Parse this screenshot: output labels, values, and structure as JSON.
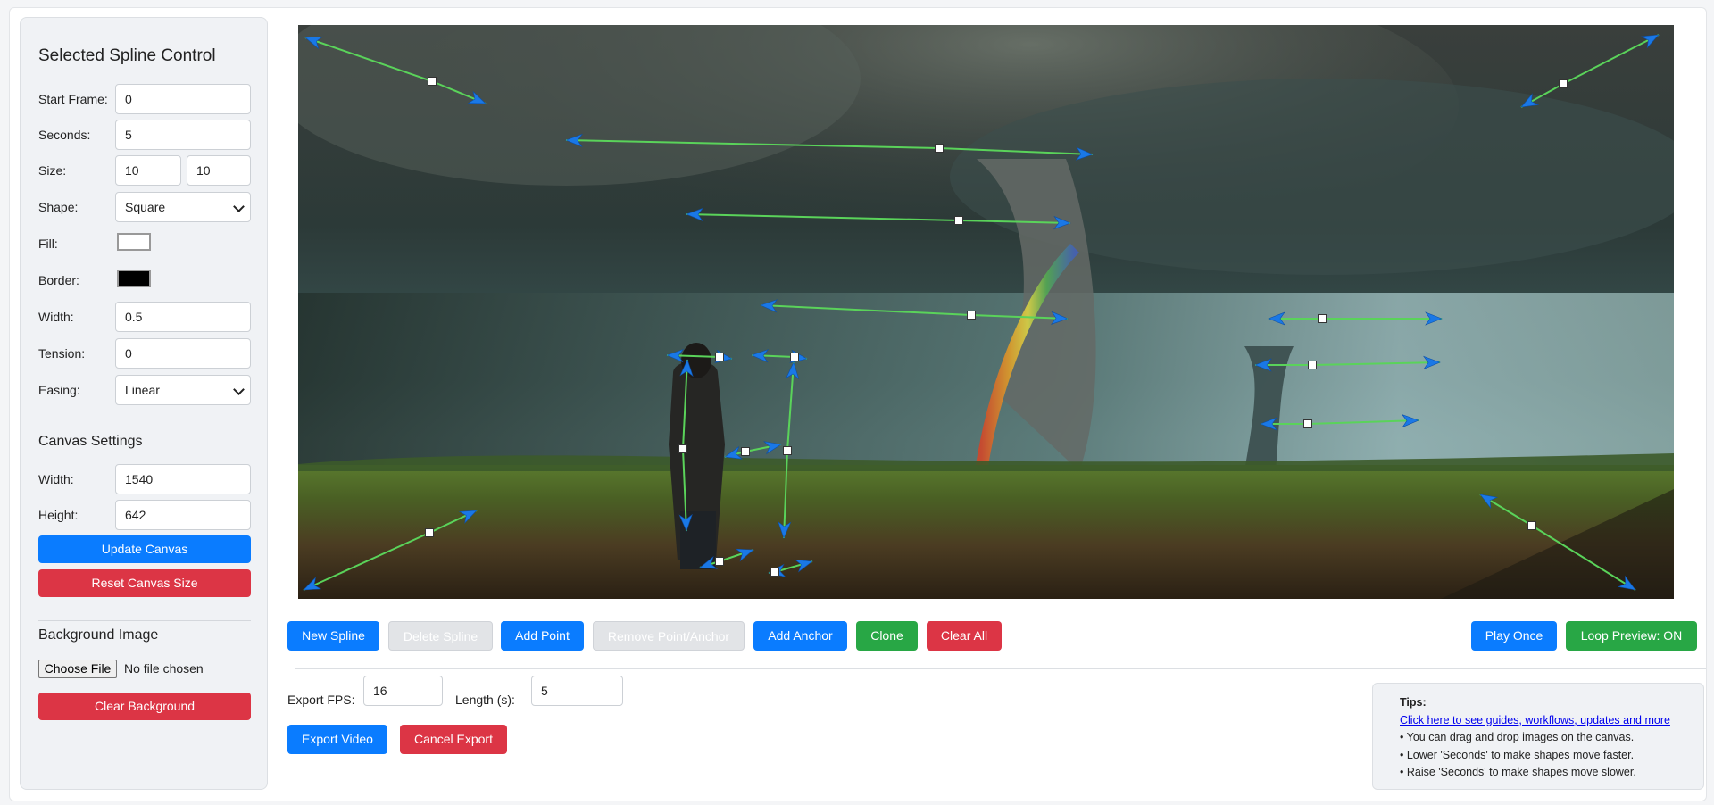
{
  "sidebar": {
    "title": "Selected Spline Control",
    "fields": {
      "start_frame": {
        "label": "Start Frame:",
        "value": "0"
      },
      "seconds": {
        "label": "Seconds:",
        "value": "5"
      },
      "size": {
        "label": "Size:",
        "value_w": "10",
        "value_h": "10"
      },
      "shape": {
        "label": "Shape:",
        "value": "Square"
      },
      "fill": {
        "label": "Fill:",
        "color": "#ffffff"
      },
      "border": {
        "label": "Border:",
        "color": "#000000"
      },
      "width": {
        "label": "Width:",
        "value": "0.5"
      },
      "tension": {
        "label": "Tension:",
        "value": "0"
      },
      "easing": {
        "label": "Easing:",
        "value": "Linear"
      }
    },
    "canvas_settings": {
      "title": "Canvas Settings",
      "width_label": "Width:",
      "width_value": "1540",
      "height_label": "Height:",
      "height_value": "642",
      "update_label": "Update Canvas",
      "reset_label": "Reset Canvas Size"
    },
    "background": {
      "title": "Background Image",
      "choose_label": "Choose File",
      "file_status": "No file chosen",
      "clear_label": "Clear Background"
    }
  },
  "toolbar": {
    "new_spline": "New Spline",
    "delete_spline": "Delete Spline",
    "add_point": "Add Point",
    "remove_point": "Remove Point/Anchor",
    "add_anchor": "Add Anchor",
    "clone": "Clone",
    "clear_all": "Clear All",
    "play_once": "Play Once",
    "loop_preview": "Loop Preview: ON"
  },
  "export": {
    "fps_label": "Export FPS:",
    "fps_value": "16",
    "length_label": "Length (s):",
    "length_value": "5",
    "export_label": "Export Video",
    "cancel_label": "Cancel Export"
  },
  "tips": {
    "title": "Tips:",
    "link": "Click here to see guides, workflows, updates and more",
    "lines": [
      "• You can drag and drop images on the canvas.",
      "• Lower 'Seconds' to make shapes move faster.",
      "• Raise 'Seconds' to make shapes move slower."
    ]
  },
  "colors": {
    "primary": "#0a7cff",
    "danger": "#dc3545",
    "success": "#28a745",
    "spline_line": "#5ad35a",
    "arrow": "#1a78e6"
  }
}
